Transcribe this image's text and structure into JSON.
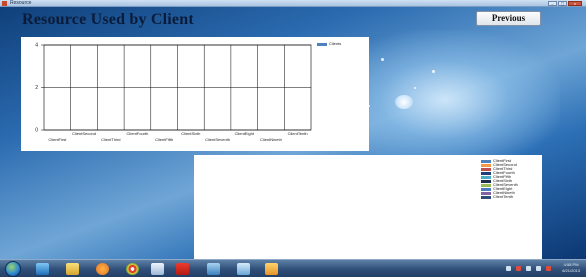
{
  "window": {
    "title": "Resource",
    "buttons": [
      "–",
      "▢",
      "x"
    ]
  },
  "heading": "Resource Used by Client",
  "previous_button": "Previous",
  "clients": [
    "ClientFirst",
    "ClientSecond",
    "ClientThird",
    "ClientFourth",
    "ClientFifth",
    "ClientSixth",
    "ClientSeventh",
    "ClientEight",
    "ClientNineth",
    "ClientTenth"
  ],
  "legend_colors": [
    "#4f81bd",
    "#c0504d",
    "#9bbb59",
    "#8064a2",
    "#4bacc6",
    "#f79646",
    "#2c4d75",
    "#772c2a",
    "#5f7530",
    "#4d3b62"
  ],
  "chart_data": {
    "type": "bar",
    "categories": [
      "ClientFirst",
      "ClientSecond",
      "ClientThird",
      "ClientFourth",
      "ClientFifth",
      "ClientSixth",
      "ClientSeventh",
      "ClientEight",
      "ClientNineth",
      "ClientTenth"
    ],
    "series": [
      {
        "name": "Clients",
        "values": [
          0,
          0,
          0,
          0,
          0,
          0,
          0,
          0,
          0,
          0
        ]
      }
    ],
    "yticks": [
      0,
      2,
      4
    ],
    "ylim": [
      0,
      4
    ],
    "grid": true,
    "legend": "top-right",
    "series_color": "#4f81bd"
  },
  "pie_legend": {
    "entries": [
      "ClientFirst",
      "ClientSecond",
      "ClientThird",
      "ClientFourth",
      "ClientFifth",
      "ClientSixth",
      "ClientSeventh",
      "ClientEight",
      "ClientNineth",
      "ClientTenth"
    ],
    "colors": [
      "#4f81bd",
      "#f79646",
      "#c0504d",
      "#1f3f7a",
      "#4bacc6",
      "#1c2e4a",
      "#9bbb59",
      "#4d7cc0",
      "#8064a2",
      "#2c4d75"
    ]
  },
  "taskbar": {
    "icons": [
      "ie-icon",
      "folder-icon",
      "media-player-icon",
      "chrome-icon",
      "notepad-icon",
      "acrobat-icon",
      "explorer-icon",
      "network-icon",
      "files-icon"
    ],
    "time": "4:58 PM",
    "date": "6/21/2013"
  }
}
